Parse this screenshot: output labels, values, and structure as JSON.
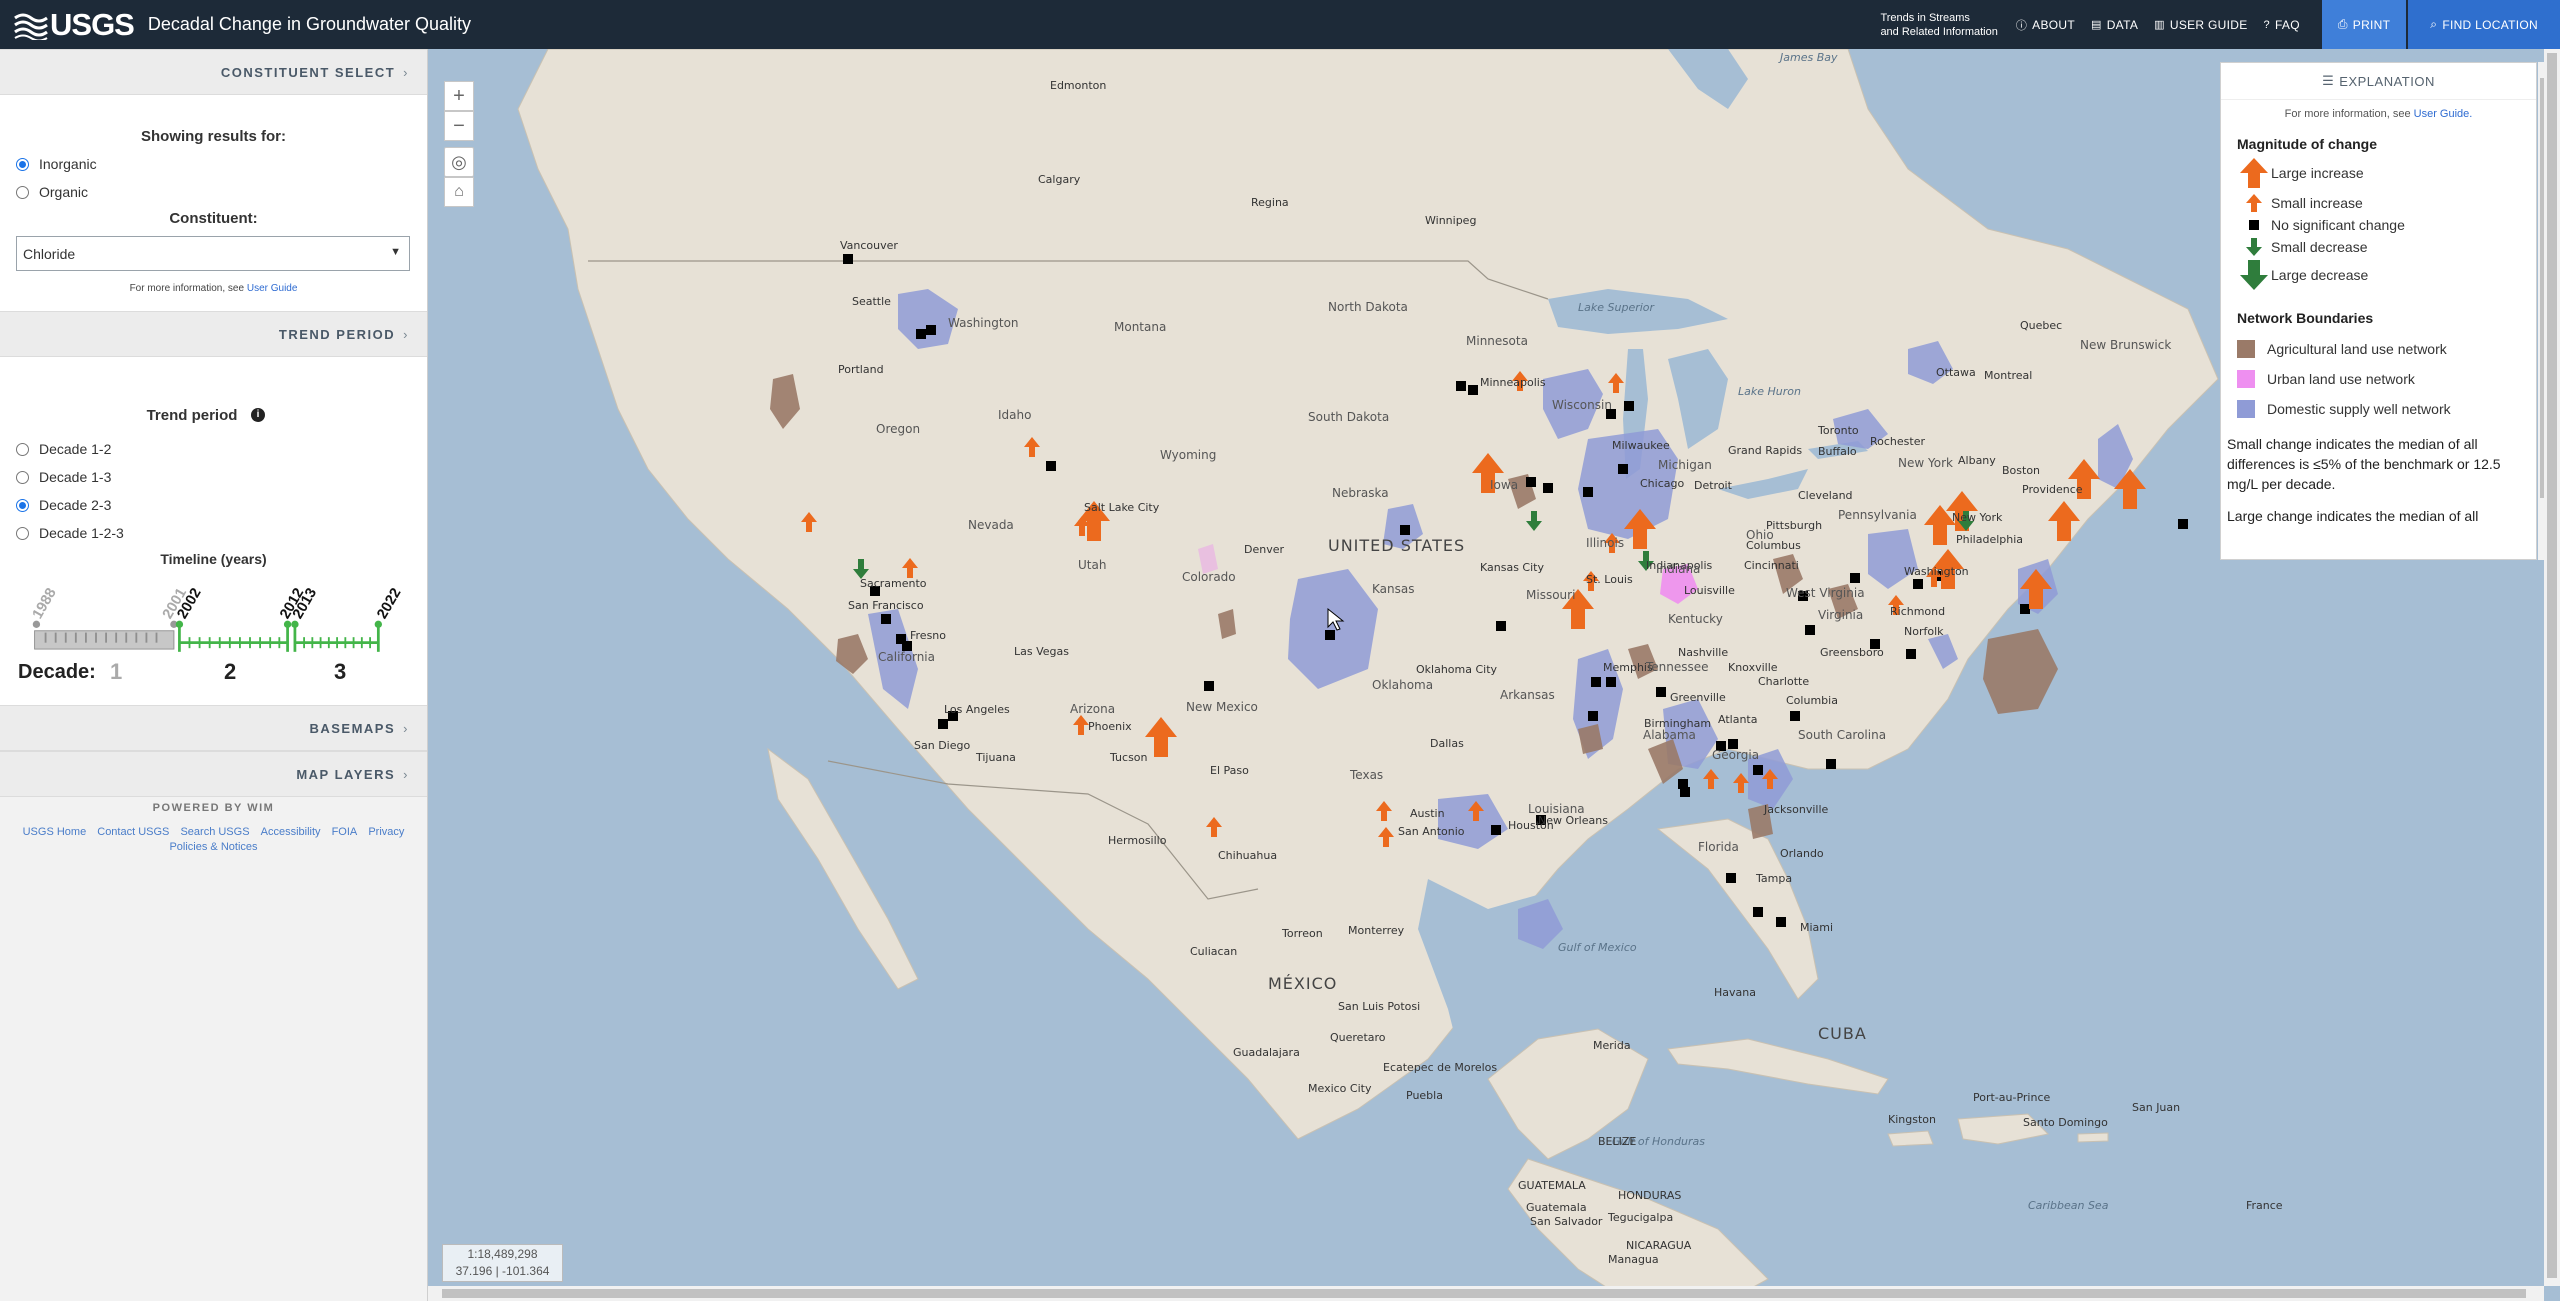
{
  "header": {
    "logo_text": "USGS",
    "title": "Decadal Change in Groundwater Quality",
    "trends_line1": "Trends in Streams",
    "trends_line2": "and Related Information",
    "nav": {
      "about": "ABOUT",
      "data": "DATA",
      "user_guide": "USER GUIDE",
      "faq": "FAQ"
    },
    "print": "PRINT",
    "find_location": "FIND LOCATION"
  },
  "sidebar": {
    "constituent_header": "CONSTITUENT SELECT",
    "showing": "Showing results for:",
    "type_inorganic": "Inorganic",
    "type_organic": "Organic",
    "selected_type": "Inorganic",
    "constituent_label": "Constituent:",
    "constituent_value": "Chloride",
    "more_info_prefix": "For more information, see",
    "more_info_link": "User Guide",
    "trend_header": "TREND PERIOD",
    "trend_title": "Trend period",
    "trend_options": [
      "Decade 1-2",
      "Decade 1-3",
      "Decade 2-3",
      "Decade 1-2-3"
    ],
    "trend_selected": "Decade 2-3",
    "timeline_title": "Timeline (years)",
    "timeline_years": [
      "1988",
      "2001",
      "2002",
      "2012",
      "2013",
      "2022"
    ],
    "decade_label": "Decade:",
    "decades": [
      "1",
      "2",
      "3"
    ],
    "basemaps_header": "BASEMAPS",
    "layers_header": "MAP LAYERS",
    "powered": "POWERED BY WIM",
    "footer_links": [
      "USGS Home",
      "Contact USGS",
      "Search USGS",
      "Accessibility",
      "FOIA",
      "Privacy",
      "Policies & Notices"
    ]
  },
  "map": {
    "scale": "1:18,489,298",
    "coords": "37.196 | -101.364",
    "labels": {
      "countries": [
        "UNITED STATES",
        "MÉXICO",
        "CUBA"
      ],
      "cities": [
        "Edmonton",
        "Calgary",
        "Regina",
        "Winnipeg",
        "Vancouver",
        "Seattle",
        "Portland",
        "Salt Lake City",
        "Denver",
        "San Francisco",
        "Sacramento",
        "Fresno",
        "Las Vegas",
        "Los Angeles",
        "San Diego",
        "Tijuana",
        "Phoenix",
        "Tucson",
        "El Paso",
        "Hermosillo",
        "Chihuahua",
        "Culiacan",
        "Torreon",
        "Monterrey",
        "San Luis Potosi",
        "Queretaro",
        "Ecatepec de Morelos",
        "Mexico City",
        "Puebla",
        "Guadalajara",
        "Merida",
        "Havana",
        "Kingston",
        "Port-au-Prince",
        "Santo Domingo",
        "San Juan",
        "Oklahoma City",
        "Dallas",
        "Austin",
        "San Antonio",
        "Houston",
        "New Orleans",
        "Kansas City",
        "Memphis",
        "Nashville",
        "Birmingham",
        "Atlanta",
        "Jacksonville",
        "Orlando",
        "Tampa",
        "Miami",
        "Charlotte",
        "Greensboro",
        "Knoxville",
        "Greenville",
        "Columbia",
        "Richmond",
        "Norfolk",
        "Washington",
        "Philadelphia",
        "New York",
        "Boston",
        "Providence",
        "Albany",
        "Pittsburgh",
        "Cleveland",
        "Columbus",
        "Cincinnati",
        "Louisville",
        "Indianapolis",
        "Chicago",
        "Milwaukee",
        "Detroit",
        "Toronto",
        "Buffalo",
        "Rochester",
        "Ottawa",
        "Montreal",
        "Quebec",
        "Grand Rapids",
        "Minneapolis",
        "St. Louis",
        "Guatemala",
        "San Salvador",
        "Tegucigalpa",
        "Managua"
      ],
      "states": [
        "Washington",
        "Oregon",
        "Idaho",
        "Montana",
        "Wyoming",
        "Nevada",
        "Utah",
        "Colorado",
        "California",
        "Arizona",
        "New Mexico",
        "North Dakota",
        "South Dakota",
        "Nebraska",
        "Kansas",
        "Oklahoma",
        "Texas",
        "Minnesota",
        "Iowa",
        "Missouri",
        "Arkansas",
        "Wisconsin",
        "Illinois",
        "Indiana",
        "Ohio",
        "Kentucky",
        "Tennessee",
        "Alabama",
        "Georgia",
        "Florida",
        "South Carolina",
        "Virginia",
        "West Virginia",
        "Pennsylvania",
        "New York",
        "Michigan",
        "Louisiana",
        "New Brunswick",
        "James Bay",
        "Gulf of Mexico",
        "Caribbean Sea",
        "Lake Superior",
        "Lake Huron",
        "Gulf of Honduras",
        "BELIZE",
        "GUATEMALA",
        "HONDURAS",
        "NICARAGUA",
        "France"
      ]
    }
  },
  "legend": {
    "title": "EXPLANATION",
    "more_info_prefix": "For more information, see",
    "more_info_link": "User Guide.",
    "magnitude_title": "Magnitude of change",
    "magnitude_items": [
      "Large increase",
      "Small increase",
      "No significant change",
      "Small decrease",
      "Large decrease"
    ],
    "network_title": "Network Boundaries",
    "network_items": [
      "Agricultural land use network",
      "Urban land use network",
      "Domestic supply well network"
    ],
    "note1": "Small change indicates the median of all differences is ≤5% of the benchmark or 12.5 mg/L per decade.",
    "note2": "Large change indicates the median of all",
    "colors": {
      "increase": "#ec6a1e",
      "decrease": "#2f7d3c",
      "no_change": "#000000",
      "agricultural": "#9a7a68",
      "urban": "#ee8ff0",
      "domestic": "#8f9bd6"
    }
  }
}
